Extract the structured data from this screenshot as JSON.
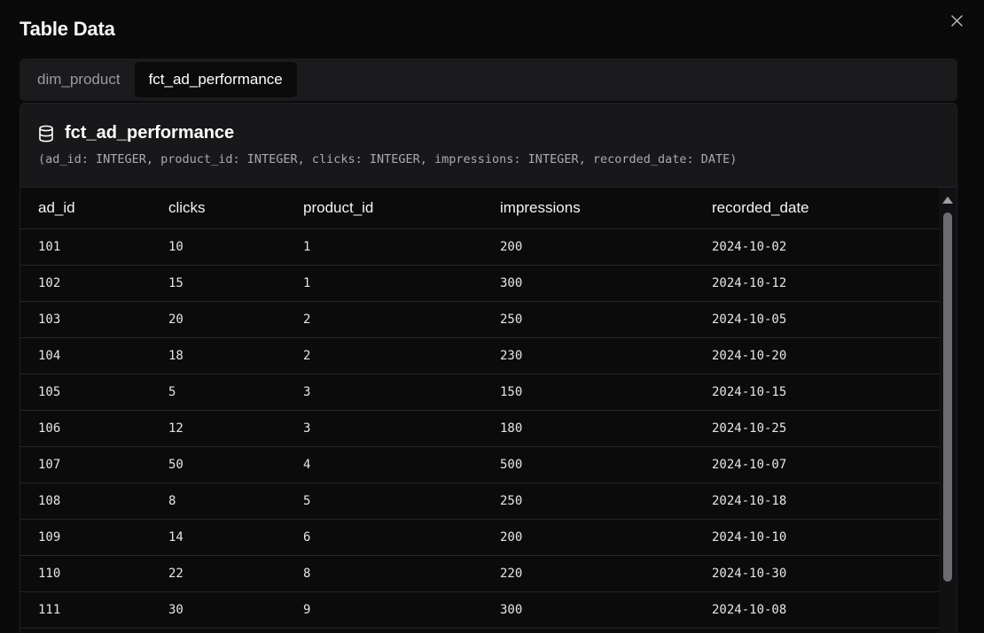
{
  "modal": {
    "title": "Table Data"
  },
  "tabs": [
    {
      "label": "dim_product",
      "active": false
    },
    {
      "label": "fct_ad_performance",
      "active": true
    }
  ],
  "panel": {
    "title": "fct_ad_performance",
    "schema": "(ad_id: INTEGER, product_id: INTEGER, clicks: INTEGER, impressions: INTEGER, recorded_date: DATE)"
  },
  "table": {
    "columns": [
      "ad_id",
      "clicks",
      "product_id",
      "impressions",
      "recorded_date"
    ],
    "rows": [
      [
        "101",
        "10",
        "1",
        "200",
        "2024-10-02"
      ],
      [
        "102",
        "15",
        "1",
        "300",
        "2024-10-12"
      ],
      [
        "103",
        "20",
        "2",
        "250",
        "2024-10-05"
      ],
      [
        "104",
        "18",
        "2",
        "230",
        "2024-10-20"
      ],
      [
        "105",
        "5",
        "3",
        "150",
        "2024-10-15"
      ],
      [
        "106",
        "12",
        "3",
        "180",
        "2024-10-25"
      ],
      [
        "107",
        "50",
        "4",
        "500",
        "2024-10-07"
      ],
      [
        "108",
        "8",
        "5",
        "250",
        "2024-10-18"
      ],
      [
        "109",
        "14",
        "6",
        "200",
        "2024-10-10"
      ],
      [
        "110",
        "22",
        "8",
        "220",
        "2024-10-30"
      ],
      [
        "111",
        "30",
        "9",
        "300",
        "2024-10-08"
      ]
    ]
  },
  "icons": {
    "close": "close-icon",
    "database": "database-icon"
  },
  "colors": {
    "background": "#0a0a0b",
    "tabbar": "#1b1b1e",
    "header": "#18181b",
    "text": "#f2f2f3"
  }
}
